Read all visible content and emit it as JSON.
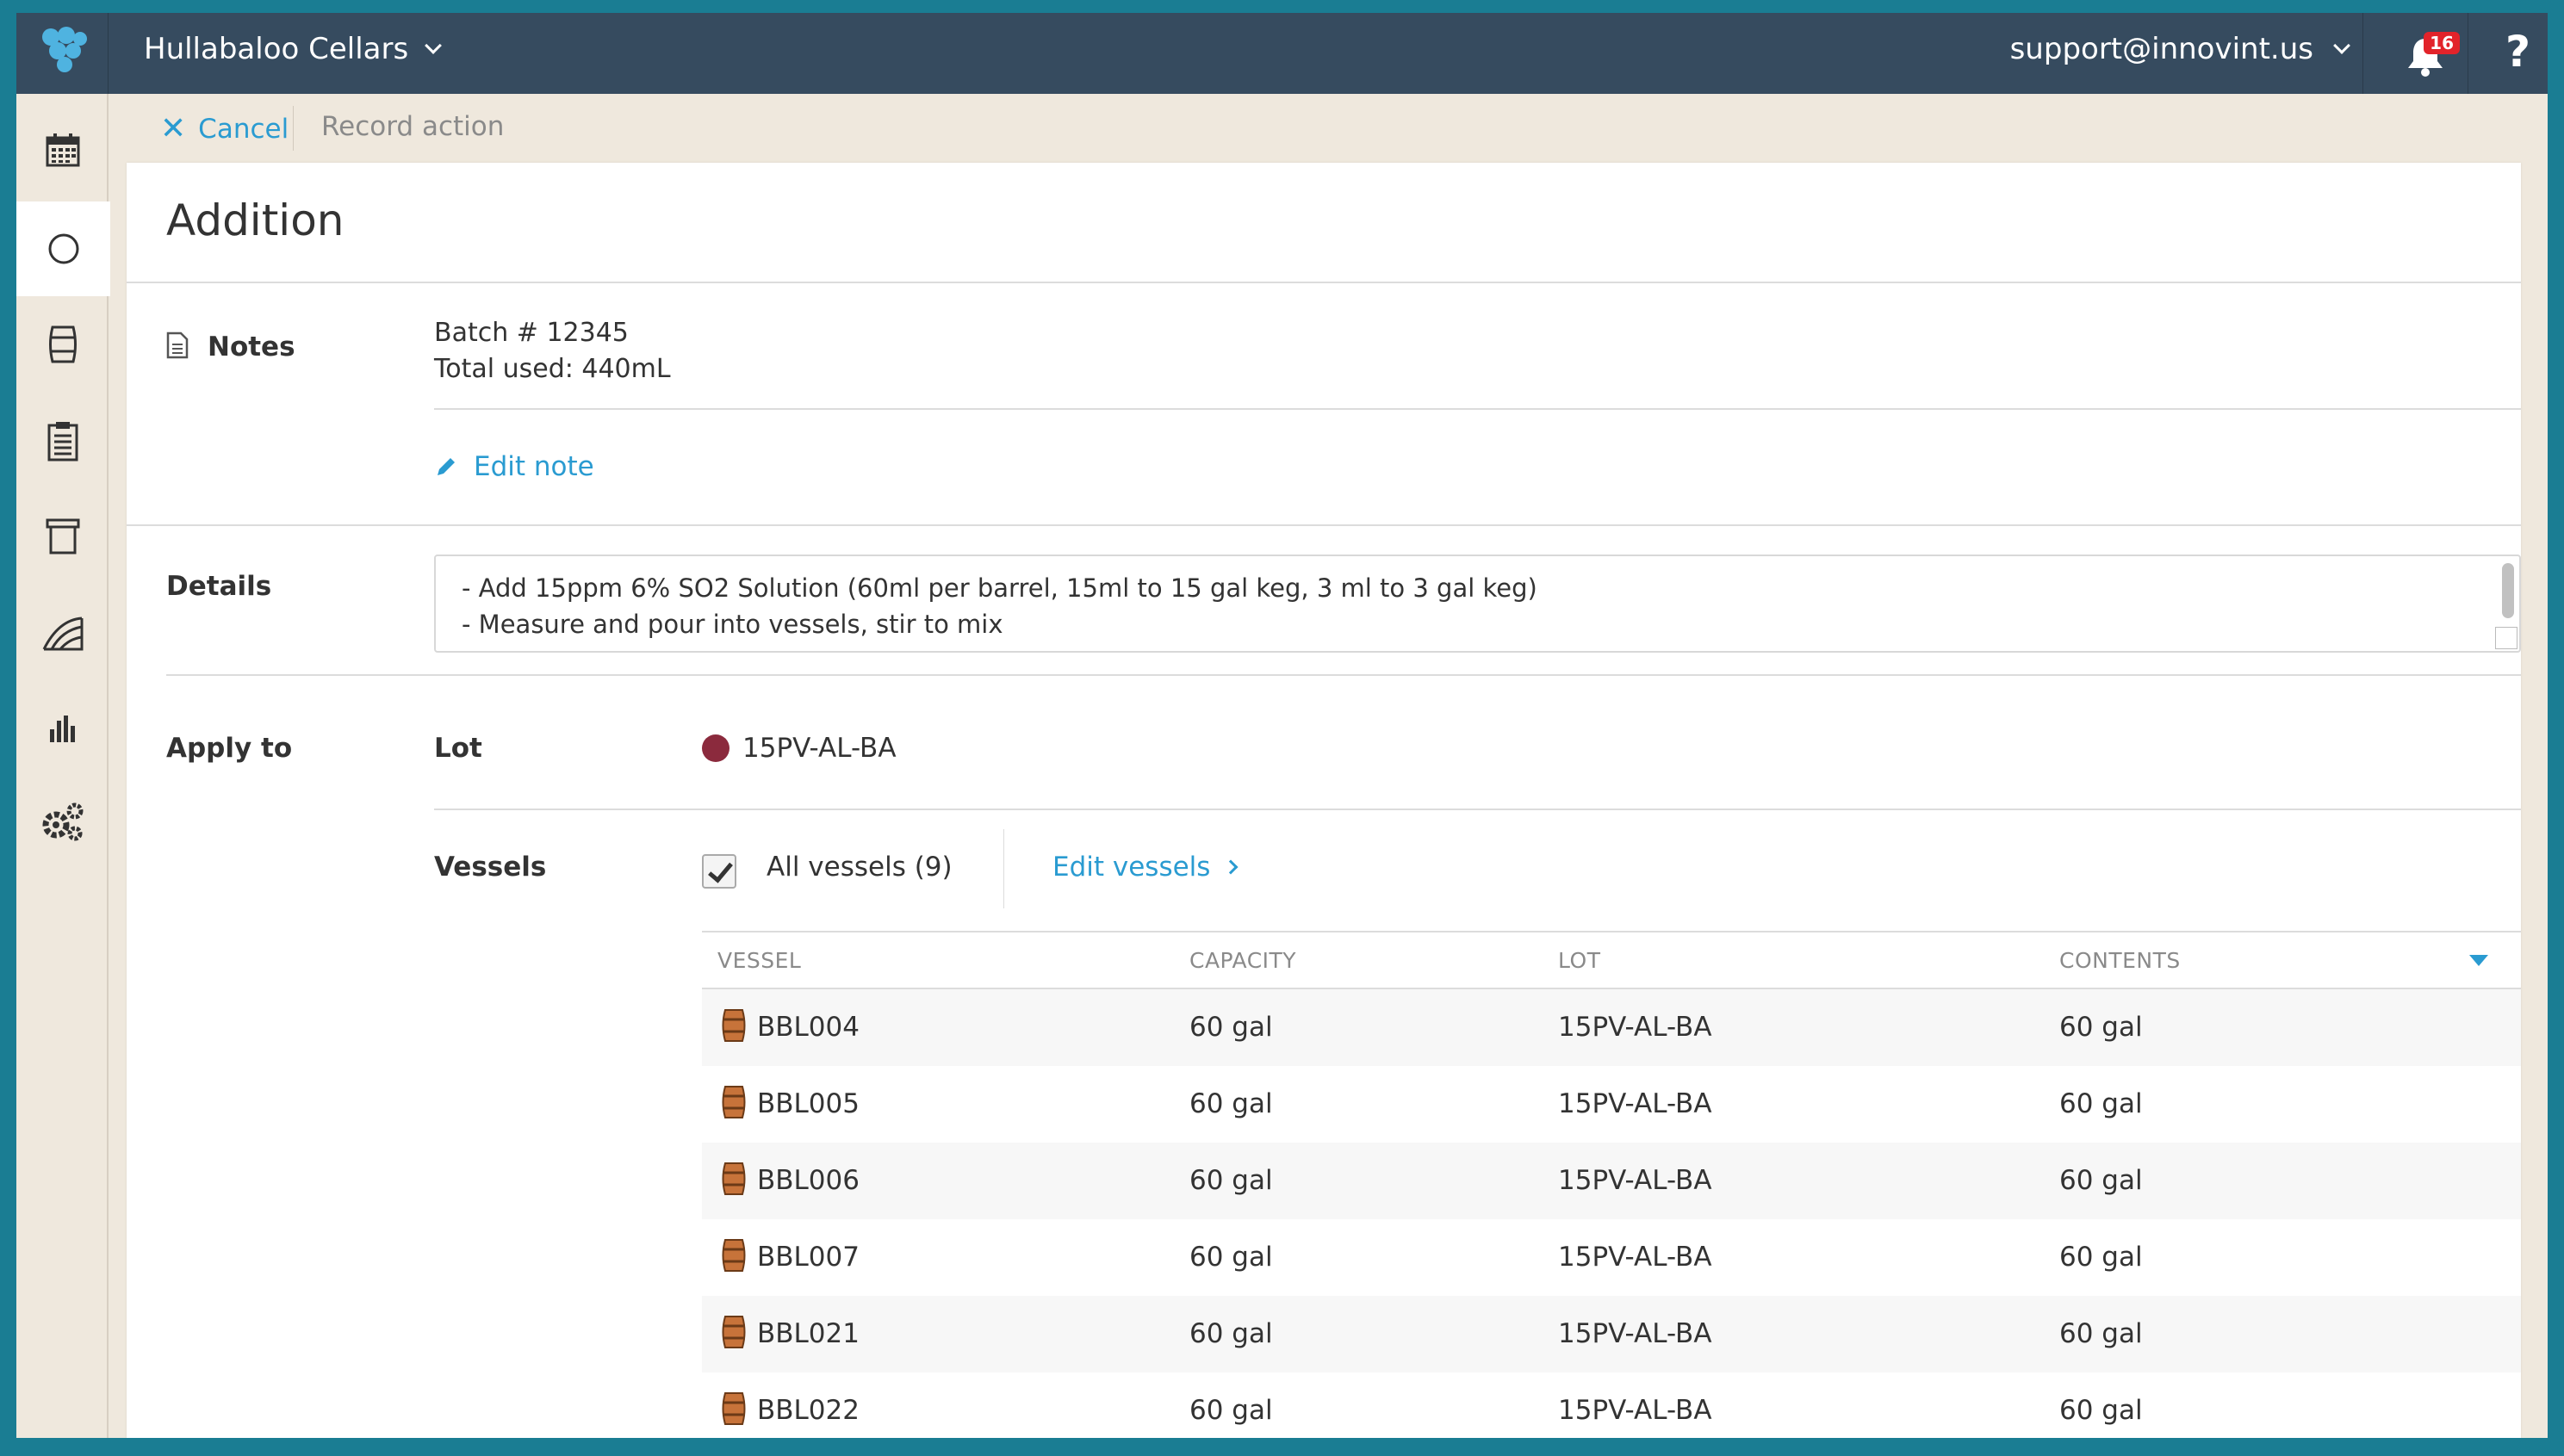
{
  "topbar": {
    "org_name": "Hullabaloo Cellars",
    "user_email": "support@innovint.us",
    "notification_count": "16",
    "help_label": "?"
  },
  "sidebar": {
    "items": [
      {
        "icon": "calendar-icon"
      },
      {
        "icon": "circle-icon",
        "active": true
      },
      {
        "icon": "barrel-icon"
      },
      {
        "icon": "clipboard-icon"
      },
      {
        "icon": "archive-icon"
      },
      {
        "icon": "vineyard-icon"
      },
      {
        "icon": "bar-chart-icon"
      },
      {
        "icon": "gears-icon"
      }
    ]
  },
  "actionbar": {
    "cancel_label": "Cancel",
    "record_label": "Record action"
  },
  "form": {
    "title": "Addition",
    "notes_label": "Notes",
    "notes_line1": "Batch # 12345",
    "notes_line2": "Total used: 440mL",
    "edit_note_label": "Edit note",
    "details_label": "Details",
    "details_line1": "- Add 15ppm 6% SO2 Solution (60ml per barrel, 15ml to 15 gal keg, 3 ml to 3 gal keg)",
    "details_line2": "- Measure and pour into vessels, stir to mix",
    "apply_to_label": "Apply to",
    "lot_label": "Lot",
    "lot_value": "15PV-AL-BA",
    "lot_color": "#8b2a3d",
    "vessels_label": "Vessels",
    "all_vessels_label": "All vessels (9)",
    "edit_vessels_label": "Edit vessels"
  },
  "table": {
    "headers": {
      "vessel": "VESSEL",
      "capacity": "CAPACITY",
      "lot": "LOT",
      "contents": "CONTENTS"
    },
    "rows": [
      {
        "vessel": "BBL004",
        "capacity": "60 gal",
        "lot": "15PV-AL-BA",
        "contents": "60 gal"
      },
      {
        "vessel": "BBL005",
        "capacity": "60 gal",
        "lot": "15PV-AL-BA",
        "contents": "60 gal"
      },
      {
        "vessel": "BBL006",
        "capacity": "60 gal",
        "lot": "15PV-AL-BA",
        "contents": "60 gal"
      },
      {
        "vessel": "BBL007",
        "capacity": "60 gal",
        "lot": "15PV-AL-BA",
        "contents": "60 gal"
      },
      {
        "vessel": "BBL021",
        "capacity": "60 gal",
        "lot": "15PV-AL-BA",
        "contents": "60 gal"
      },
      {
        "vessel": "BBL022",
        "capacity": "60 gal",
        "lot": "15PV-AL-BA",
        "contents": "60 gal"
      }
    ]
  },
  "colors": {
    "accent": "#2a9bd1",
    "topbar": "#364b5f",
    "frame": "#1a7d93"
  }
}
